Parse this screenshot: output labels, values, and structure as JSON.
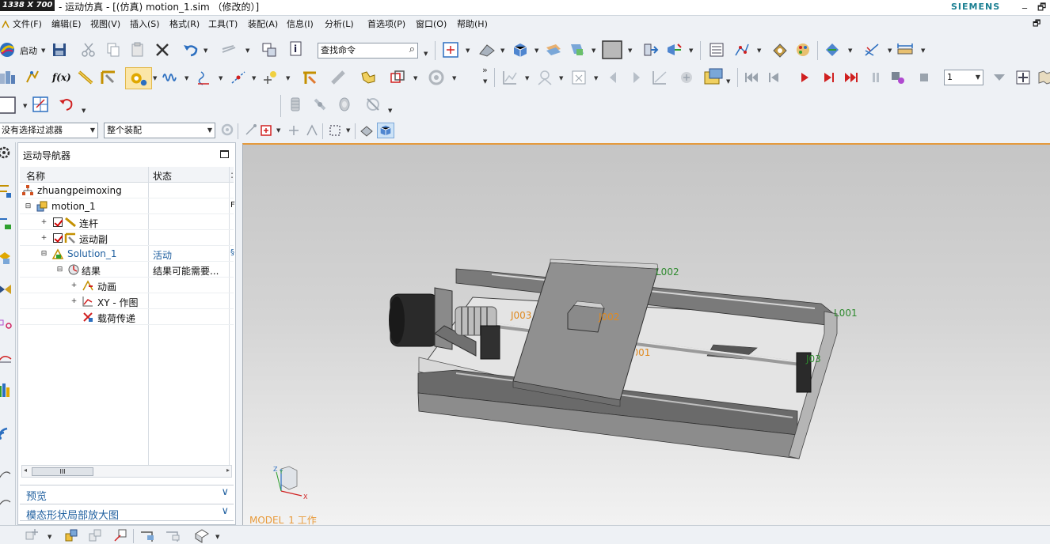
{
  "titlebar": {
    "size_badge": "1338 X 700",
    "title": "- 运动仿真 - [(仿真) motion_1.sim （修改的）]",
    "brand": "SIEMENS",
    "min_btn": "_",
    "restore_btn": "🗗"
  },
  "menubar": {
    "items": [
      "文件(F)",
      "编辑(E)",
      "视图(V)",
      "插入(S)",
      "格式(R)",
      "工具(T)",
      "装配(A)",
      "信息(I)",
      "分析(L)",
      "首选项(P)",
      "窗口(O)",
      "帮助(H)"
    ],
    "restore_btn": "🗗"
  },
  "toolbar": {
    "start_label": "启动",
    "find_command": "查找命令",
    "fx_label": "f(x)",
    "step_value": "1"
  },
  "filters": {
    "selection_filter": "没有选择过滤器",
    "scope": "整个装配"
  },
  "navigator": {
    "title": "运动导航器",
    "col_name": "名称",
    "col_status": "状态",
    "rows": [
      {
        "label": "zhuangpeimoxing",
        "status": ""
      },
      {
        "label": "motion_1",
        "status": ""
      },
      {
        "label": "连杆",
        "status": ""
      },
      {
        "label": "运动副",
        "status": ""
      },
      {
        "label": "Solution_1",
        "status": "活动"
      },
      {
        "label": "结果",
        "status": "结果可能需要..."
      },
      {
        "label": "动画",
        "status": ""
      },
      {
        "label": "XY - 作图",
        "status": ""
      },
      {
        "label": "载荷传递",
        "status": ""
      }
    ],
    "scroll_thumb": "III",
    "panels": [
      "预览",
      "模态形状局部放大图"
    ]
  },
  "viewport": {
    "labels": {
      "L002": "L002",
      "L001": "L001",
      "J003": "J003",
      "J002": "J002",
      "J001": "J001",
      "J03": "J03"
    },
    "work_label": "MODEL_1 工作"
  },
  "colors": {
    "accent": "#1f5f9f",
    "viewport_border": "#e59a3c",
    "brand": "#1a7f92"
  }
}
